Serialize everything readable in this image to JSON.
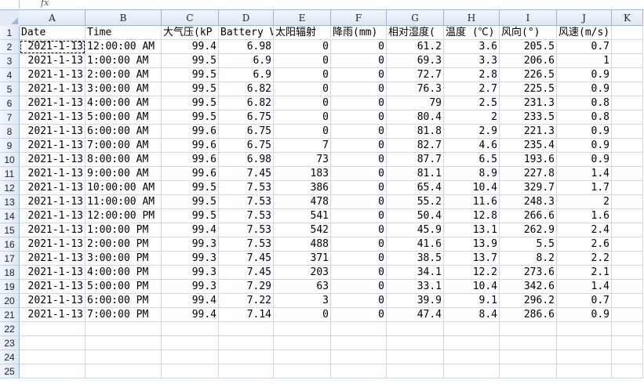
{
  "formula_bar": {
    "fx_label": "fx"
  },
  "columns": [
    "A",
    "B",
    "C",
    "D",
    "E",
    "F",
    "G",
    "H",
    "I",
    "J",
    "K"
  ],
  "header_row": [
    "Date",
    "Time",
    "大气压(kP",
    "Battery V",
    "太阳辐射",
    "降雨(mm)",
    "相对湿度(",
    "温度 (℃)",
    "风向(°)",
    "风速(m/s)",
    ""
  ],
  "rows": [
    [
      "2021-1-13",
      "12:00:00 AM",
      "99.4",
      "6.98",
      "0",
      "0",
      "61.2",
      "3.6",
      "205.5",
      "0.7"
    ],
    [
      "2021-1-13",
      "1:00:00 AM",
      "99.5",
      "6.9",
      "0",
      "0",
      "69.3",
      "3.3",
      "206.6",
      "1"
    ],
    [
      "2021-1-13",
      "2:00:00 AM",
      "99.5",
      "6.9",
      "0",
      "0",
      "72.7",
      "2.8",
      "226.5",
      "0.9"
    ],
    [
      "2021-1-13",
      "3:00:00 AM",
      "99.5",
      "6.82",
      "0",
      "0",
      "76.3",
      "2.7",
      "225.5",
      "0.9"
    ],
    [
      "2021-1-13",
      "4:00:00 AM",
      "99.5",
      "6.82",
      "0",
      "0",
      "79",
      "2.5",
      "231.3",
      "0.8"
    ],
    [
      "2021-1-13",
      "5:00:00 AM",
      "99.5",
      "6.75",
      "0",
      "0",
      "80.4",
      "2",
      "233.5",
      "0.8"
    ],
    [
      "2021-1-13",
      "6:00:00 AM",
      "99.6",
      "6.75",
      "0",
      "0",
      "81.8",
      "2.9",
      "221.3",
      "0.9"
    ],
    [
      "2021-1-13",
      "7:00:00 AM",
      "99.6",
      "6.75",
      "7",
      "0",
      "82.7",
      "4.6",
      "235.4",
      "0.9"
    ],
    [
      "2021-1-13",
      "8:00:00 AM",
      "99.6",
      "6.98",
      "73",
      "0",
      "87.7",
      "6.5",
      "193.6",
      "0.9"
    ],
    [
      "2021-1-13",
      "9:00:00 AM",
      "99.6",
      "7.45",
      "183",
      "0",
      "81.1",
      "8.9",
      "227.8",
      "1.4"
    ],
    [
      "2021-1-13",
      "10:00:00 AM",
      "99.5",
      "7.53",
      "386",
      "0",
      "65.4",
      "10.4",
      "329.7",
      "1.7"
    ],
    [
      "2021-1-13",
      "11:00:00 AM",
      "99.5",
      "7.53",
      "478",
      "0",
      "55.2",
      "11.6",
      "248.3",
      "2"
    ],
    [
      "2021-1-13",
      "12:00:00 PM",
      "99.5",
      "7.53",
      "541",
      "0",
      "50.4",
      "12.8",
      "266.6",
      "1.6"
    ],
    [
      "2021-1-13",
      "1:00:00 PM",
      "99.4",
      "7.53",
      "542",
      "0",
      "45.9",
      "13.1",
      "262.9",
      "2.4"
    ],
    [
      "2021-1-13",
      "2:00:00 PM",
      "99.3",
      "7.53",
      "488",
      "0",
      "41.6",
      "13.9",
      "5.5",
      "2.6"
    ],
    [
      "2021-1-13",
      "3:00:00 PM",
      "99.3",
      "7.45",
      "371",
      "0",
      "38.5",
      "13.7",
      "8.2",
      "2.2"
    ],
    [
      "2021-1-13",
      "4:00:00 PM",
      "99.3",
      "7.45",
      "203",
      "0",
      "34.1",
      "12.2",
      "273.6",
      "2.1"
    ],
    [
      "2021-1-13",
      "5:00:00 PM",
      "99.3",
      "7.29",
      "63",
      "0",
      "33.1",
      "10.4",
      "342.6",
      "1.4"
    ],
    [
      "2021-1-13",
      "6:00:00 PM",
      "99.4",
      "7.22",
      "3",
      "0",
      "39.9",
      "9.1",
      "296.2",
      "0.7"
    ],
    [
      "2021-1-13",
      "7:00:00 PM",
      "99.4",
      "7.14",
      "0",
      "0",
      "47.4",
      "8.4",
      "286.6",
      "0.9"
    ]
  ],
  "row_numbers": [
    "1",
    "2",
    "3",
    "4",
    "5",
    "6",
    "7",
    "8",
    "9",
    "10",
    "11",
    "12",
    "13",
    "14",
    "15",
    "16",
    "17",
    "18",
    "19",
    "20",
    "21",
    "22",
    "23",
    "24",
    "25"
  ]
}
